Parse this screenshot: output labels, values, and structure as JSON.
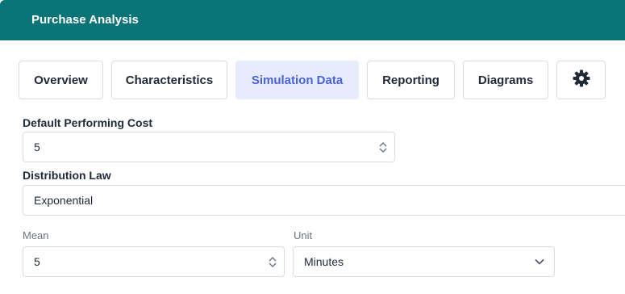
{
  "header": {
    "title": "Purchase Analysis"
  },
  "tabs": [
    {
      "label": "Overview",
      "active": false
    },
    {
      "label": "Characteristics",
      "active": false
    },
    {
      "label": "Simulation Data",
      "active": true
    },
    {
      "label": "Reporting",
      "active": false
    },
    {
      "label": "Diagrams",
      "active": false
    }
  ],
  "settings_icon": "gear-icon",
  "form": {
    "default_cost": {
      "label": "Default Performing Cost",
      "value": "5"
    },
    "distribution": {
      "label": "Distribution Law",
      "value": "Exponential"
    },
    "mean": {
      "label": "Mean",
      "value": "5"
    },
    "unit": {
      "label": "Unit",
      "value": "Minutes"
    }
  },
  "colors": {
    "header_bg": "#0b7476",
    "active_tab_bg": "#e6ecfb",
    "active_tab_text": "#4a63d6"
  }
}
